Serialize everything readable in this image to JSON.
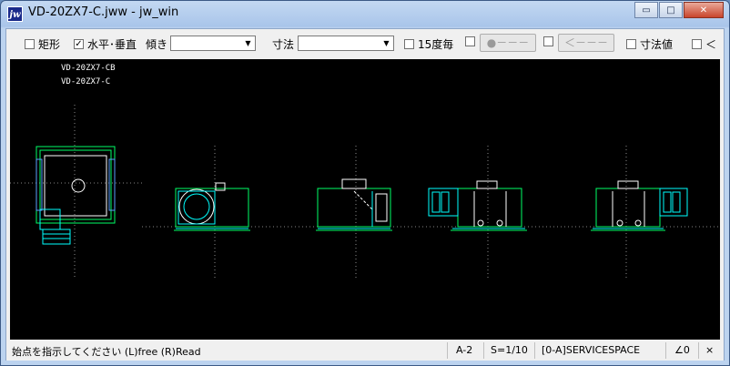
{
  "window": {
    "title": "VD-20ZX7-C.jww - jw_win",
    "app_icon_text": "jw"
  },
  "titlebar_buttons": {
    "minimize": "▭",
    "maximize": "□",
    "close": "✕"
  },
  "toolbar": {
    "rect_label": "矩形",
    "hv_label": "水平･垂直",
    "hv_check": "✓",
    "tilt_label": "傾き",
    "dim_label": "寸法",
    "deg15_label": "15度毎",
    "point_button": "●－－－",
    "arrow_button": "＜－－－",
    "dimval_label": "寸法値",
    "more_label": "＜",
    "dropdown_arrow": "▼"
  },
  "canvas": {
    "label1": "VD-20ZX7-CB",
    "label2": "VD-20ZX7-C"
  },
  "status": {
    "prompt": "始点を指示してください (L)free (R)Read",
    "sheet": "A-2",
    "scale": "S=1/10",
    "layer": "[0-A]SERVICESPACE",
    "angle": "∠0",
    "close": "×"
  },
  "colors": {
    "cad_bg": "#000000",
    "cad_green": "#00ff66",
    "cad_cyan": "#00ffff",
    "cad_white": "#ffffff",
    "cad_blue": "#5aa0ff"
  }
}
